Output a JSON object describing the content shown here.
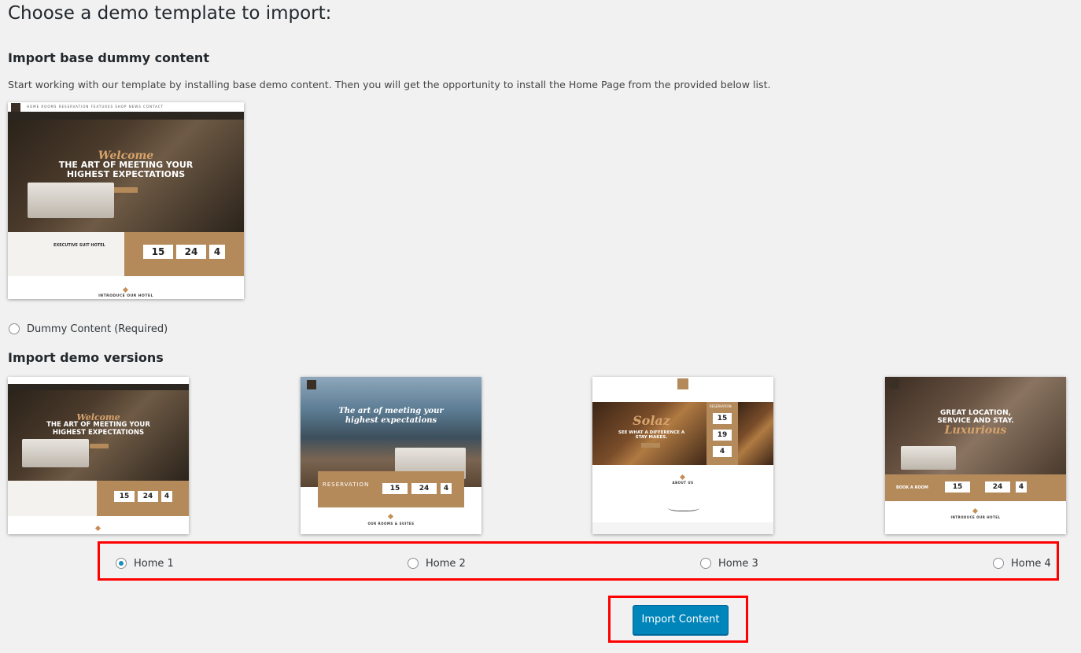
{
  "page": {
    "title": "Choose a demo template to import:",
    "base_heading": "Import base dummy content",
    "base_description": "Start working with our template by installing base demo content. Then you will get the opportunity to install the Home Page from the provided below list.",
    "dummy_option_label": "Dummy Content (Required)",
    "versions_heading": "Import demo versions"
  },
  "preview": {
    "welcome": "Welcome",
    "headline_line1": "THE ART OF MEETING YOUR",
    "headline_line2": "HIGHEST EXPECTATIONS",
    "nav_links": "HOME  ROOMS  RESERVATION  FEATURES  SHOP  NEWS  CONTACT",
    "executive": "EXECUTIVE SUIT HOTEL",
    "date1": "15",
    "date2": "24",
    "date3": "4",
    "intro": "INTRODUCE OUR HOTEL",
    "home2_script": "The art of meeting your highest expectations",
    "home2_reservation": "RESERVATION",
    "home2_rooms": "OUR ROOMS & SUITES",
    "home3_script": "Solaz",
    "home3_title": "SEE WHAT A DIFFERENCE A STAY MAKES.",
    "home3_reservation": "RESERVATION",
    "home3_d1": "15",
    "home3_d2": "19",
    "home3_d3": "4",
    "home3_about": "ABOUT US",
    "home4_title": "GREAT LOCATION, SERVICE AND STAY.",
    "home4_script": "Luxurious",
    "home4_book": "BOOK A ROOM"
  },
  "versions": [
    {
      "label": "Home 1",
      "checked": true
    },
    {
      "label": "Home 2",
      "checked": false
    },
    {
      "label": "Home 3",
      "checked": false
    },
    {
      "label": "Home 4",
      "checked": false
    }
  ],
  "actions": {
    "import_label": "Import Content"
  },
  "colors": {
    "accent": "#0085ba",
    "highlight": "#ff0000",
    "brand_gold": "#b58a5b"
  }
}
